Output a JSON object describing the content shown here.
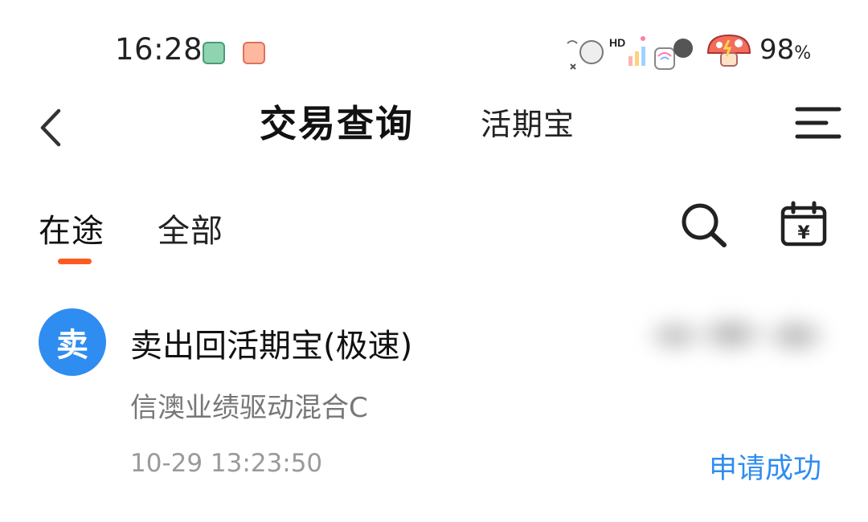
{
  "status_bar": {
    "time": "16:28",
    "battery_value": "98",
    "battery_unit": "%",
    "icons": [
      "sticker-icon",
      "sticker-icon",
      "nfc-icon",
      "hd-icon",
      "signal-icon",
      "wifi-icon",
      "battery-mushroom-icon"
    ]
  },
  "header": {
    "title": "交易查询",
    "subtitle": "活期宝",
    "back_icon": "chevron-left-icon",
    "menu_icon": "menu-icon"
  },
  "tabs": [
    {
      "label": "在途",
      "active": true
    },
    {
      "label": "全部",
      "active": false
    }
  ],
  "toolbar": {
    "search_icon": "search-icon",
    "calendar_icon": "calendar-yen-icon",
    "calendar_glyph": "¥"
  },
  "accent": "#ff5a1f",
  "transactions": [
    {
      "avatar_text": "卖",
      "title": "卖出回活期宝(极速)",
      "fund_name": "信澳业绩驱动混合C",
      "time": "10-29 13:23:50",
      "status": "申请成功",
      "status_color": "#2f8cf0"
    }
  ]
}
